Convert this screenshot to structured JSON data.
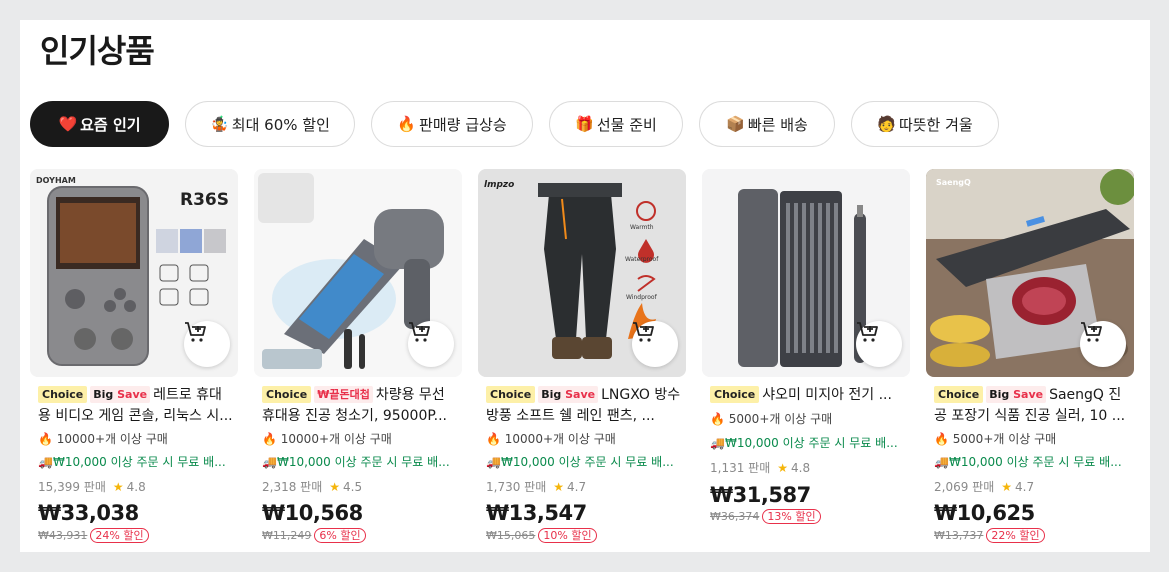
{
  "section": {
    "title": "인기상품"
  },
  "tabs": [
    {
      "icon": "❤️",
      "label": "요즘 인기",
      "active": true
    },
    {
      "icon": "🤹",
      "label": "최대 60% 할인",
      "active": false
    },
    {
      "icon": "🔥",
      "label": "판매량 급상승",
      "active": false
    },
    {
      "icon": "🎁",
      "label": "선물 준비",
      "active": false
    },
    {
      "icon": "📦",
      "label": "빠른 배송",
      "active": false
    },
    {
      "icon": "🧑",
      "label": "따뜻한 겨울",
      "active": false
    }
  ],
  "products": [
    {
      "image_text": [
        "R36S",
        "DOYHAM"
      ],
      "badge_choice": "Choice",
      "badge_bigsave_1": "Big",
      "badge_bigsave_2": "Save",
      "badge_deal": "",
      "title": "레트로 휴대용 비디오 게임 콘솔, 리눅스 시...",
      "sold_icon": "🔥",
      "sold": "10000+개 이상 구매",
      "ship_icon": "🚚",
      "shipping": "₩10,000 이상 주문 시 무료 배...",
      "sales": "15,399 판매",
      "star": "★",
      "rating": "4.8",
      "price": "₩33,038",
      "original_price": "₩43,931",
      "discount": "24% 할인"
    },
    {
      "image_text": [],
      "badge_choice": "Choice",
      "badge_bigsave_1": "",
      "badge_bigsave_2": "",
      "badge_deal": "₩끝돈대첩",
      "title": "차량용 무선 휴대용 진공 청소기, 95000P...",
      "sold_icon": "🔥",
      "sold": "10000+개 이상 구매",
      "ship_icon": "🚚",
      "shipping": "₩10,000 이상 주문 시 무료 배...",
      "sales": "2,318 판매",
      "star": "★",
      "rating": "4.5",
      "price": "₩10,568",
      "original_price": "₩11,249",
      "discount": "6% 할인"
    },
    {
      "image_text": [
        "lmpzo",
        "Warmth",
        "Waterproof",
        "Windproof"
      ],
      "badge_choice": "Choice",
      "badge_bigsave_1": "Big",
      "badge_bigsave_2": "Save",
      "badge_deal": "",
      "title": "LNGXO 방수 방풍 소프트 쉘 레인 팬츠, ...",
      "sold_icon": "🔥",
      "sold": "10000+개 이상 구매",
      "ship_icon": "🚚",
      "shipping": "₩10,000 이상 주문 시 무료 배...",
      "sales": "1,730 판매",
      "star": "★",
      "rating": "4.7",
      "price": "₩13,547",
      "original_price": "₩15,065",
      "discount": "10% 할인"
    },
    {
      "image_text": [],
      "badge_choice": "Choice",
      "badge_bigsave_1": "",
      "badge_bigsave_2": "",
      "badge_deal": "",
      "title": "샤오미 미지아 전기 ...",
      "sold_icon": "🔥",
      "sold": "5000+개 이상 구매",
      "ship_icon": "🚚",
      "shipping": "₩10,000 이상 주문 시 무료 배...",
      "sales": "1,131 판매",
      "star": "★",
      "rating": "4.8",
      "price": "₩31,587",
      "original_price": "₩36,374",
      "discount": "13% 할인"
    },
    {
      "image_text": [
        "SaengQ"
      ],
      "badge_choice": "Choice",
      "badge_bigsave_1": "Big",
      "badge_bigsave_2": "Save",
      "badge_deal": "",
      "title": "SaengQ 진공 포장기 식품 진공 실러, 10 ...",
      "sold_icon": "🔥",
      "sold": "5000+개 이상 구매",
      "ship_icon": "🚚",
      "shipping": "₩10,000 이상 주문 시 무료 배...",
      "sales": "2,069 판매",
      "star": "★",
      "rating": "4.7",
      "price": "₩10,625",
      "original_price": "₩13,737",
      "discount": "22% 할인"
    }
  ]
}
